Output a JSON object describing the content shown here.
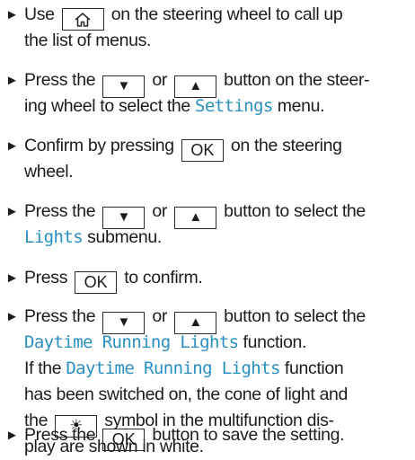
{
  "steps": [
    {
      "lines": [
        [
          "Use ",
          {
            "key": "home-icon"
          },
          " on the steering wheel to call up"
        ],
        [
          "the list of menus."
        ]
      ]
    },
    {
      "lines": [
        [
          "Press the ",
          {
            "key": "down-arrow-icon",
            "glyph": "▼"
          },
          " or ",
          {
            "key": "up-arrow-icon",
            "glyph": "▲"
          },
          " button on the steer-"
        ],
        [
          "ing wheel to select the ",
          {
            "mono": "Settings"
          },
          " menu."
        ]
      ]
    },
    {
      "lines": [
        [
          "Confirm by pressing ",
          {
            "key": "ok-key",
            "glyph": "OK"
          },
          " on the steering"
        ],
        [
          "wheel."
        ]
      ]
    },
    {
      "lines": [
        [
          "Press the ",
          {
            "key": "down-arrow-icon",
            "glyph": "▼"
          },
          " or ",
          {
            "key": "up-arrow-icon",
            "glyph": "▲"
          },
          " button to select the"
        ],
        [
          {
            "mono": "Lights"
          },
          " submenu."
        ]
      ]
    },
    {
      "lines": [
        [
          "Press ",
          {
            "key": "ok-key",
            "glyph": "OK"
          },
          " to confirm."
        ]
      ]
    },
    {
      "lines": [
        [
          "Press the ",
          {
            "key": "down-arrow-icon",
            "glyph": "▼"
          },
          " or ",
          {
            "key": "up-arrow-icon",
            "glyph": "▲"
          },
          " button to select the"
        ],
        [
          {
            "mono": "Daytime Running Lights"
          },
          " function."
        ],
        [
          "If the ",
          {
            "mono": "Daytime Running Lights"
          },
          " function"
        ],
        [
          "has been switched on, the cone of light and"
        ],
        [
          "the ",
          {
            "key": "light-icon",
            "glyph": "☀"
          },
          " symbol in the multifunction dis-"
        ],
        [
          "play are shown in white."
        ]
      ]
    },
    {
      "lines": [
        [
          "Press the ",
          {
            "key": "ok-key",
            "glyph": "OK"
          },
          " button to save the setting."
        ]
      ]
    }
  ],
  "bullet_glyph": "►"
}
